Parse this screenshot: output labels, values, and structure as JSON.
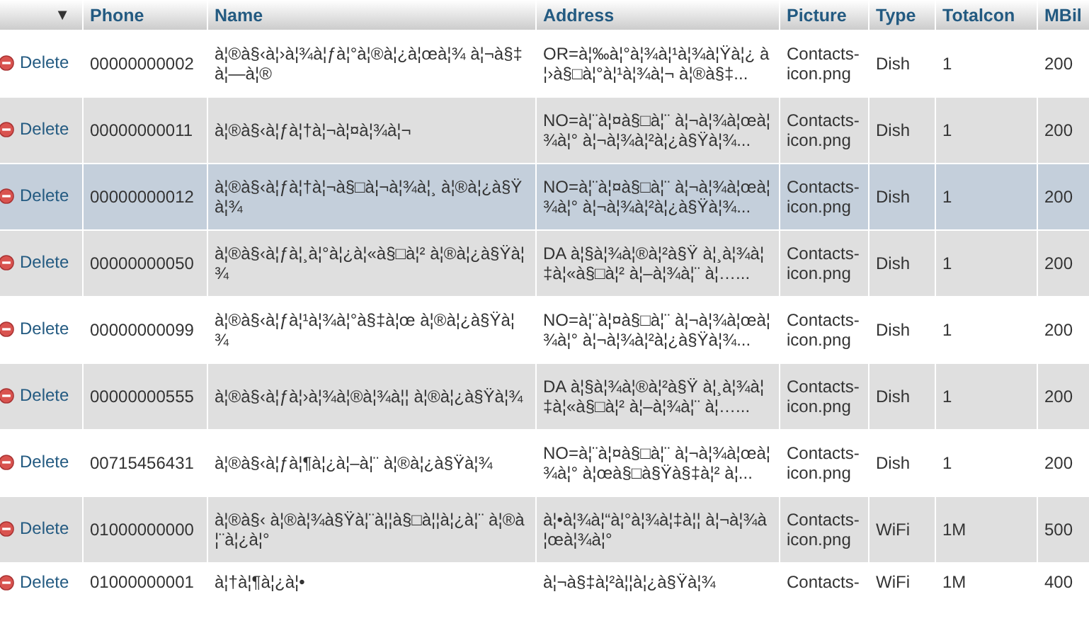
{
  "table": {
    "sort_caret": "▼",
    "columns": [
      "Phone",
      "Name",
      "Address",
      "Picture",
      "Type",
      "Totalcon",
      "MBil"
    ],
    "rows": [
      {
        "action": "Delete",
        "highlighted": false,
        "cells": [
          "00000000002",
          "à¦®à§‹à¦›à¦¾à¦ƒà¦°à¦®à¦¿à¦œà¦¾ à¦¬à§‡à¦—à¦®",
          "OR=à¦‰à¦°à¦¾à¦¹à¦¾à¦Ÿà¦¿ à¦›à§□à¦°à¦¹à¦¾à¦¬ à¦®à§‡...",
          "Contacts-icon.png",
          "Dish",
          "1",
          "200"
        ]
      },
      {
        "action": "Delete",
        "highlighted": false,
        "cells": [
          "00000000011",
          "à¦®à§‹à¦ƒà¦†à¦¬à¦¤à¦¾à¦¬",
          "NO=à¦¨à¦¤à§□à¦¨ à¦¬à¦¾à¦œà¦¾à¦° à¦¬à¦¾à¦²à¦¿à§Ÿà¦¾...",
          "Contacts-icon.png",
          "Dish",
          "1",
          "200"
        ]
      },
      {
        "action": "Delete",
        "highlighted": true,
        "cells": [
          "00000000012",
          "à¦®à§‹à¦ƒà¦†à¦¬à§□à¦¬à¦¾à¦¸ à¦®à¦¿à§Ÿà¦¾",
          "NO=à¦¨à¦¤à§□à¦¨ à¦¬à¦¾à¦œà¦¾à¦° à¦¬à¦¾à¦²à¦¿à§Ÿà¦¾...",
          "Contacts-icon.png",
          "Dish",
          "1",
          "200"
        ]
      },
      {
        "action": "Delete",
        "highlighted": false,
        "cells": [
          "00000000050",
          "à¦®à§‹à¦ƒà¦¸à¦°à¦¿à¦«à§□à¦² à¦®à¦¿à§Ÿà¦¾",
          "DA à¦§à¦¾à¦®à¦²à§Ÿ à¦¸à¦¾à¦‡à¦«à§□à¦² à¦–à¦¾à¦¨ à¦…...",
          "Contacts-icon.png",
          "Dish",
          "1",
          "200"
        ]
      },
      {
        "action": "Delete",
        "highlighted": false,
        "cells": [
          "00000000099",
          "à¦®à§‹à¦ƒà¦¹à¦¾à¦°à§‡à¦œ à¦®à¦¿à§Ÿà¦¾",
          "NO=à¦¨à¦¤à§□à¦¨ à¦¬à¦¾à¦œà¦¾à¦° à¦¬à¦¾à¦²à¦¿à§Ÿà¦¾...",
          "Contacts-icon.png",
          "Dish",
          "1",
          "200"
        ]
      },
      {
        "action": "Delete",
        "highlighted": false,
        "cells": [
          "00000000555",
          "à¦®à§‹à¦ƒà¦›à¦¾à¦®à¦¾à¦¦ à¦®à¦¿à§Ÿà¦¾",
          "DA à¦§à¦¾à¦®à¦²à§Ÿ à¦¸à¦¾à¦‡à¦«à§□à¦² à¦–à¦¾à¦¨ à¦…...",
          "Contacts-icon.png",
          "Dish",
          "1",
          "200"
        ]
      },
      {
        "action": "Delete",
        "highlighted": false,
        "cells": [
          "00715456431",
          "à¦®à§‹à¦ƒà¦¶à¦¿à¦–à¦¨ à¦®à¦¿à§Ÿà¦¾",
          "NO=à¦¨à¦¤à§□à¦¨ à¦¬à¦¾à¦œà¦¾à¦° à¦œà§□à§Ÿà§‡à¦² à¦...",
          "Contacts-icon.png",
          "Dish",
          "1",
          "200"
        ]
      },
      {
        "action": "Delete",
        "highlighted": false,
        "cells": [
          "01000000000",
          "à¦®à§‹ à¦®à¦¾à§Ÿà¦¨à¦¦à§□à¦¦à¦¿à¦¨ à¦®à¦¨à¦¿à¦°",
          "à¦•à¦¾à¦“à¦°à¦¾à¦‡à¦¦ à¦¬à¦¾à¦œà¦¾à¦°",
          "Contacts-icon.png",
          "WiFi",
          "1M",
          "500"
        ]
      },
      {
        "action": "Delete",
        "highlighted": false,
        "cells": [
          "01000000001",
          "à¦†à¦¶à¦¿à¦•",
          "à¦¬à§‡à¦²à¦¦à¦¿à§Ÿà¦¾",
          "Contacts-",
          "WiFi",
          "1M",
          "400"
        ]
      }
    ]
  }
}
